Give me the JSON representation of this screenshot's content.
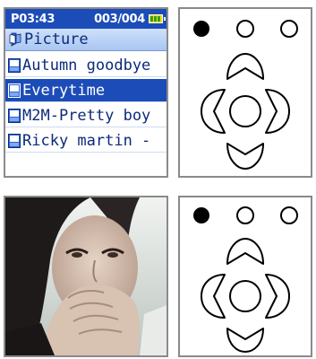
{
  "status": {
    "time": "P03:43",
    "track_counter": "003/004",
    "battery_icon": "battery-icon"
  },
  "folder": {
    "icon": "folder-icon",
    "title": "Picture"
  },
  "files": [
    {
      "label": "Autumn goodbye",
      "selected": false
    },
    {
      "label": "Everytime",
      "selected": true
    },
    {
      "label": "M2M-Pretty boy",
      "selected": false
    },
    {
      "label": "Ricky martin -",
      "selected": false
    }
  ],
  "colors": {
    "title_bar": "#1c4cb8",
    "folder_bar": "#b5cdf5",
    "text": "#0b2a7a",
    "selection": "#1c4cb8",
    "battery": "#ffdc00"
  },
  "control_pads": [
    {
      "name": "control-pad-top",
      "active_indicator": 1,
      "indicators": 3
    },
    {
      "name": "control-pad-bottom",
      "active_indicator": 1,
      "indicators": 3
    }
  ],
  "photo": {
    "icon": "photo-woman-image"
  }
}
